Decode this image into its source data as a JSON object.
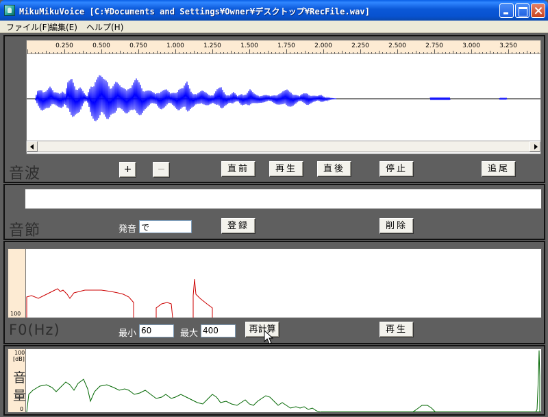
{
  "window": {
    "title": "MikuMikuVoice [C:¥Documents and Settings¥Owner¥デスクトップ¥RecFile.wav]",
    "icon": "miku-app-icon"
  },
  "menu": {
    "items": [
      {
        "label": "ファイル(F)"
      },
      {
        "label": "編集(E)"
      },
      {
        "label": "ヘルプ(H)"
      }
    ]
  },
  "waveform": {
    "section_title": "音波",
    "ruler_ticks": [
      "0.250",
      "0.500",
      "0.750",
      "1.000",
      "1.250",
      "1.500",
      "1.750",
      "2.000",
      "2.250",
      "2.500",
      "2.750",
      "3.000",
      "3.250"
    ],
    "buttons": {
      "zoom_in": "+",
      "zoom_out": "−",
      "prev": "直前",
      "play": "再生",
      "next": "直後",
      "stop": "停止",
      "follow": "追尾"
    },
    "waveform_color": "#0000ff"
  },
  "syllable": {
    "section_title": "音節",
    "pronunciation_label": "発音",
    "pronunciation_value": "で",
    "register": "登録",
    "delete": "削除"
  },
  "f0": {
    "section_title": "F0(Hz)",
    "axis_min_label": "100",
    "min_label": "最小",
    "min_value": "60",
    "max_label": "最大",
    "max_value": "400",
    "recalc": "再計算",
    "play": "再生",
    "line_color": "#cc0000"
  },
  "volume": {
    "section_title": "音量",
    "axis_top": "100",
    "axis_unit": "[dB]",
    "axis_bottom": "0",
    "line_color": "#006600"
  }
}
